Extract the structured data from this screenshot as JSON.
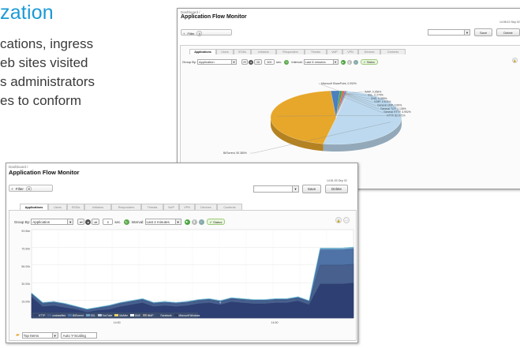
{
  "marketing": {
    "heading": "zation",
    "lines": [
      "cations, ingress",
      "eb sites visited",
      "s administrators",
      "es to conform"
    ]
  },
  "back_window": {
    "breadcrumb": "Dashboard /",
    "title": "Application Flow Monitor",
    "timestamp": "14:08:10 Sep 02",
    "filter_label": "Filter",
    "filter_x": "X",
    "save_label": "Save",
    "delete_label": "Delete",
    "tabs": [
      "Applications",
      "Users",
      "SSIDs",
      "Initiators",
      "Responders",
      "Threats",
      "VoIP",
      "VPN",
      "Devices",
      "Contents"
    ],
    "active_tab": 0,
    "group_by_label": "Group By:",
    "group_by_value": "Application",
    "step_back": "⏮",
    "top_count": "15",
    "seconds_value": "600",
    "seconds_label": "sec.",
    "interval_label": "Interval:",
    "interval_value": "Last 5 minutes",
    "status_label": "Status",
    "pie_labels": [
      "Microsoft SharePoint, 0.092%",
      "IMAP, 0.256%",
      "SSL, 0.279%",
      "DNS, 0.399%",
      "ICMP, 0.675%",
      "General UDP, 0.99%",
      "General TCP, 1.135%",
      "General HTTP, 3.992%",
      "HTTP, 82.071%",
      "BitTorrent, 90.380%"
    ]
  },
  "front_window": {
    "breadcrumb": "Dashboard /",
    "title": "Application Flow Monitor",
    "timestamp": "14:51:03 Sep 02",
    "filter_label": "Filter",
    "filter_x": "X",
    "save_label": "Save",
    "delete_label": "Delete",
    "tabs": [
      "Applications",
      "Users",
      "SSIDs",
      "Initiators",
      "Responders",
      "Threats",
      "VoIP",
      "VPN",
      "Devices",
      "Contents"
    ],
    "active_tab": 0,
    "group_by_label": "Group By:",
    "group_by_value": "Application",
    "top_count": "5",
    "seconds_label": "sec.",
    "interval_label": "Interval:",
    "interval_value": "Last 2 minutes",
    "status_label": "Status",
    "legend": [
      "HTTP",
      "unclassified",
      "BitTorrent",
      "SSL",
      "YouTube",
      "McAfee",
      "DNS",
      "IMAP",
      "Facebook",
      "Microsoft Windows"
    ],
    "bottom_select": "Top Items",
    "auto_scaling": "Auto Y-Scaling"
  },
  "chart_data": [
    {
      "type": "pie",
      "title": "",
      "categories": [
        "BitTorrent",
        "HTTP",
        "General HTTP",
        "General TCP",
        "General UDP",
        "ICMP",
        "DNS",
        "SSL",
        "IMAP",
        "Microsoft SharePoint"
      ],
      "values": [
        90.38,
        82.071,
        3.992,
        1.135,
        0.99,
        0.675,
        0.399,
        0.279,
        0.256,
        0.092
      ],
      "colors": [
        "#bcd9ef",
        "#e7a72a",
        "#4a7fc0",
        "#3fa54a",
        "#e95b3c",
        "#7b6bd0",
        "#45b8c7",
        "#8bbf3f",
        "#d08acb",
        "#9a9a9a"
      ]
    },
    {
      "type": "area",
      "title": "",
      "xlabel": "",
      "ylabel": "",
      "yticks": [
        "93.5kb",
        "75.50k",
        "56.00k",
        "30.00k",
        "15.00k"
      ],
      "ylim": [
        0,
        93.5
      ],
      "xticks": [
        "14:50",
        "14:50"
      ],
      "grid": true,
      "legend_position": "bottom",
      "series": [
        {
          "name": "HTTP",
          "color": "#2e3f73",
          "values": [
            22,
            12,
            13,
            11,
            9,
            6,
            8,
            9,
            12,
            14,
            16,
            12,
            13,
            12,
            13,
            15,
            16,
            14,
            17,
            16,
            15,
            15,
            16,
            16,
            18,
            14,
            36,
            36,
            36,
            37
          ]
        },
        {
          "name": "unclassified",
          "color": "#47608e",
          "values": [
            3,
            3,
            3,
            3,
            2,
            2,
            2,
            3,
            3,
            3,
            3,
            3,
            3,
            3,
            3,
            3,
            3,
            3,
            3,
            3,
            3,
            3,
            3,
            3,
            3,
            3,
            20,
            20,
            20,
            20
          ]
        },
        {
          "name": "BitTorrent",
          "color": "#4f73a7",
          "values": [
            1,
            1,
            1,
            1,
            1,
            1,
            1,
            1,
            1,
            1,
            1,
            1,
            1,
            1,
            1,
            1,
            1,
            1,
            1,
            1,
            1,
            1,
            1,
            1,
            1,
            1,
            16,
            16,
            16,
            16
          ]
        },
        {
          "name": "SSL",
          "color": "#6f9ec9",
          "values": [
            0.5,
            0.5,
            0.5,
            0.5,
            0.5,
            0.5,
            0.5,
            0.5,
            0.5,
            0.5,
            0.5,
            0.5,
            0.5,
            0.5,
            0.5,
            0.5,
            0.5,
            0.5,
            0.5,
            0.5,
            0.5,
            0.5,
            0.5,
            0.5,
            0.5,
            0.5,
            2,
            2,
            2,
            2
          ]
        }
      ]
    }
  ]
}
